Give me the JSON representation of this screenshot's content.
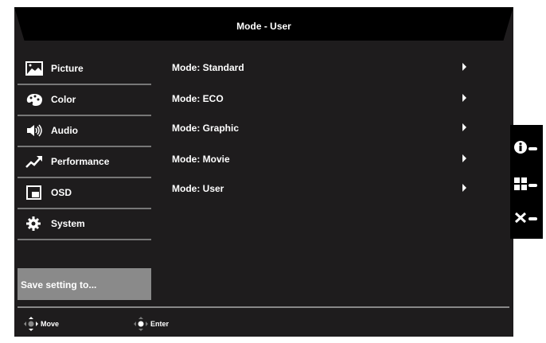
{
  "header": {
    "title": "Mode - User"
  },
  "sidebar": {
    "items": [
      {
        "label": "Picture",
        "icon": "picture-icon"
      },
      {
        "label": "Color",
        "icon": "palette-icon"
      },
      {
        "label": "Audio",
        "icon": "speaker-icon"
      },
      {
        "label": "Performance",
        "icon": "trend-up-icon"
      },
      {
        "label": "OSD",
        "icon": "osd-icon"
      },
      {
        "label": "System",
        "icon": "gear-icon"
      }
    ],
    "save_label": "Save setting to..."
  },
  "modes": [
    {
      "label": "Mode: Standard"
    },
    {
      "label": "Mode: ECO"
    },
    {
      "label": "Mode: Graphic"
    },
    {
      "label": "Mode: Movie"
    },
    {
      "label": "Mode: User"
    }
  ],
  "footer": {
    "move": "Move",
    "enter": "Enter"
  },
  "panel": {
    "info": "i",
    "x": "✕"
  }
}
